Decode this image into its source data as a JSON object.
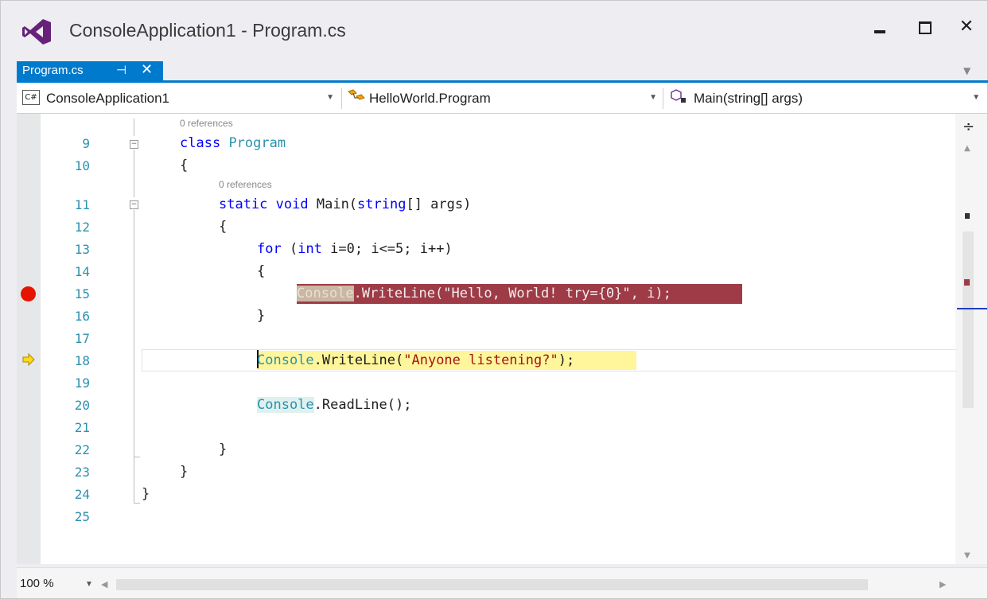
{
  "window": {
    "title": "ConsoleApplication1 - Program.cs",
    "accent_color": "#007acc",
    "logo_icon": "visual-studio-logo-icon",
    "controls": {
      "minimize_icon": "minimize-icon",
      "maximize_icon": "maximize-icon",
      "close_label": "✕"
    }
  },
  "tabs": [
    {
      "label": "Program.cs",
      "pin_glyph": "⊣",
      "close_glyph": "✕",
      "active": true
    }
  ],
  "navbar": {
    "project": "ConsoleApplication1",
    "project_icon_label": "C#",
    "type": "HelloWorld.Program",
    "member": "Main(string[] args)"
  },
  "editor": {
    "code_lens": [
      "0 references",
      "0 references"
    ],
    "line_numbers": [
      "9",
      "10",
      "11",
      "12",
      "13",
      "14",
      "15",
      "16",
      "17",
      "18",
      "19",
      "20",
      "21",
      "22",
      "23",
      "24",
      "25"
    ],
    "breakpoint_line": "15",
    "current_statement_line": "18",
    "breakpoint_color": "#e51400",
    "lines": {
      "l9": "class Program",
      "l10": "{",
      "l11": "static void Main(string[] args)",
      "l12": "{",
      "l13": "for (int i=0; i<=5; i++)",
      "l14": "{",
      "l15": "Console.WriteLine(\"Hello, World! try={0}\", i);",
      "l16": "}",
      "l18": "Console.WriteLine(\"Anyone listening?\");",
      "l20": "Console.ReadLine();",
      "l22": "}",
      "l23": "}",
      "l24": "}"
    }
  },
  "status": {
    "zoom": "100 %"
  }
}
